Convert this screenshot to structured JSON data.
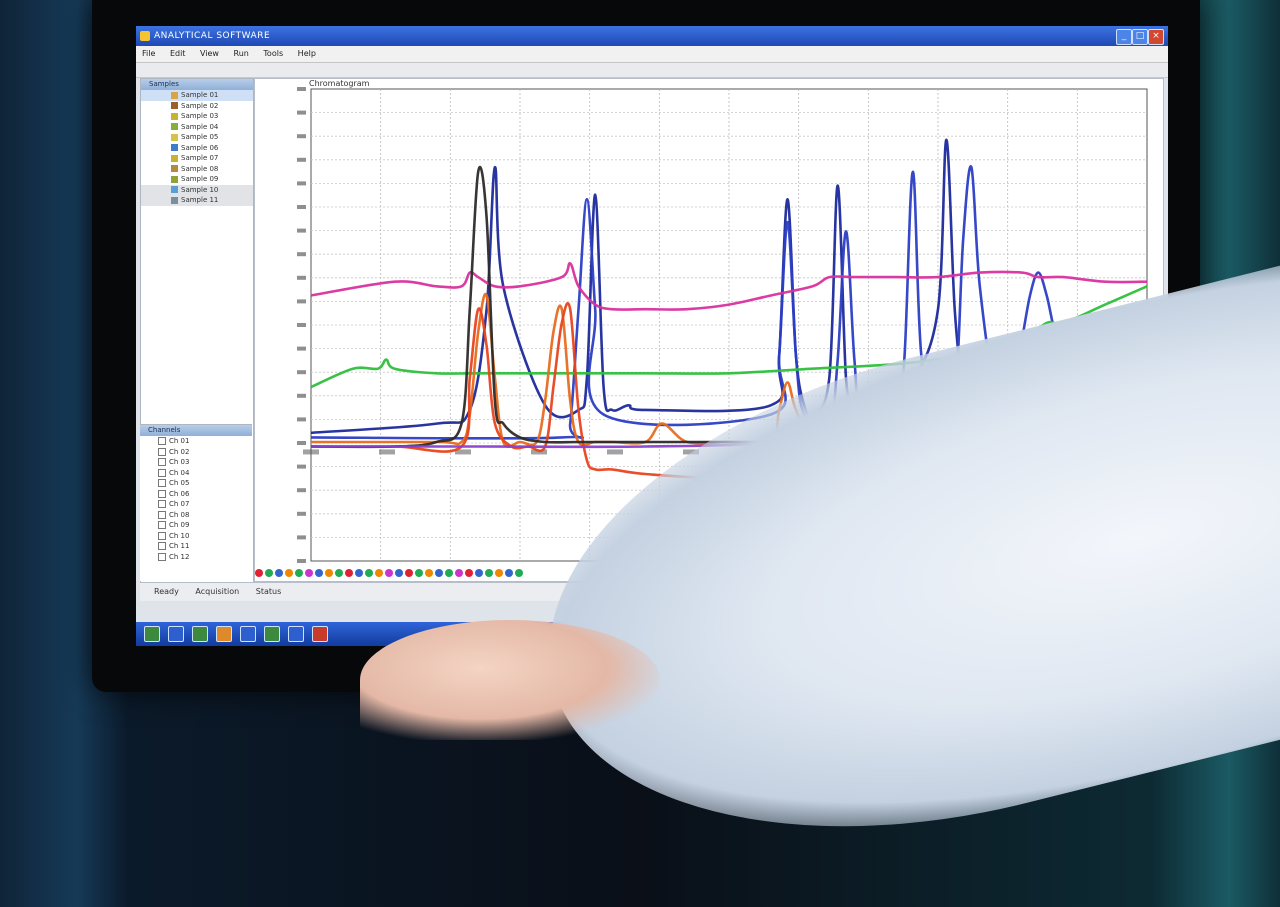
{
  "window": {
    "title": "ANALYTICAL SOFTWARE",
    "controls": [
      "_",
      "□",
      "×"
    ]
  },
  "menu": [
    "File",
    "Edit",
    "View",
    "Run",
    "Tools",
    "Help"
  ],
  "left_panel": {
    "header": "Samples",
    "rows": [
      {
        "label": "Sample 01",
        "color": "#d9a441"
      },
      {
        "label": "Sample 02",
        "color": "#9b5e2e"
      },
      {
        "label": "Sample 03",
        "color": "#c7b32f"
      },
      {
        "label": "Sample 04",
        "color": "#87ad3e"
      },
      {
        "label": "Sample 05",
        "color": "#d6c14a"
      },
      {
        "label": "Sample 06",
        "color": "#3e7cc9"
      },
      {
        "label": "Sample 07",
        "color": "#c7b32f"
      },
      {
        "label": "Sample 08",
        "color": "#b38a3e"
      },
      {
        "label": "Sample 09",
        "color": "#8fa33a"
      },
      {
        "label": "Sample 10",
        "color": "#5a9fd4"
      },
      {
        "label": "Sample 11",
        "color": "#7a8e9d"
      }
    ],
    "lower_header": "Channels",
    "lower_rows": [
      "Ch 01",
      "Ch 02",
      "Ch 03",
      "Ch 04",
      "Ch 05",
      "Ch 06",
      "Ch 07",
      "Ch 08",
      "Ch 09",
      "Ch 10",
      "Ch 11",
      "Ch 12"
    ]
  },
  "plot_header": "Chromatogram",
  "status": [
    "Ready",
    "Acquisition",
    "Status"
  ],
  "chart_data": {
    "type": "line",
    "ylim": [
      0,
      1
    ],
    "xlim": [
      0,
      100
    ],
    "grid": true,
    "x_tick_count": 11,
    "series": [
      {
        "color": "#1c2a9c",
        "x": [
          0,
          15,
          19,
          21,
          22,
          23,
          28,
          32,
          33,
          34,
          35,
          36,
          38,
          40,
          55,
          56,
          57,
          58,
          59,
          60,
          62,
          63,
          64,
          65,
          66,
          67,
          72,
          75,
          76,
          77,
          78,
          79,
          80,
          82,
          85,
          90,
          95,
          100
        ],
        "y": [
          0.28,
          0.3,
          0.33,
          0.55,
          0.86,
          0.6,
          0.34,
          0.33,
          0.4,
          0.8,
          0.38,
          0.33,
          0.34,
          0.33,
          0.34,
          0.45,
          0.79,
          0.45,
          0.34,
          0.32,
          0.4,
          0.82,
          0.4,
          0.34,
          0.34,
          0.35,
          0.4,
          0.55,
          0.92,
          0.55,
          0.38,
          0.36,
          0.4,
          0.38,
          0.36,
          0.35,
          0.34,
          0.33
        ]
      },
      {
        "color": "#2b3ec4",
        "x": [
          0,
          30,
          31,
          32,
          33,
          34,
          35,
          55,
          56,
          57,
          58,
          59,
          62,
          63,
          64,
          65,
          66,
          70,
          71,
          72,
          73,
          75,
          77,
          78,
          79,
          80,
          82,
          84,
          85,
          86,
          87,
          88,
          89,
          90,
          92,
          94,
          96,
          98,
          100
        ],
        "y": [
          0.27,
          0.27,
          0.3,
          0.55,
          0.79,
          0.55,
          0.32,
          0.32,
          0.45,
          0.74,
          0.45,
          0.32,
          0.3,
          0.44,
          0.72,
          0.44,
          0.3,
          0.3,
          0.45,
          0.85,
          0.45,
          0.3,
          0.35,
          0.7,
          0.86,
          0.6,
          0.36,
          0.4,
          0.48,
          0.58,
          0.63,
          0.58,
          0.5,
          0.48,
          0.49,
          0.48,
          0.53,
          0.47,
          0.45
        ]
      },
      {
        "color": "#d8329f",
        "x": [
          0,
          10,
          15,
          18,
          19,
          20,
          22,
          25,
          30,
          31,
          32,
          34,
          36,
          40,
          45,
          50,
          55,
          60,
          62,
          65,
          70,
          75,
          80,
          85,
          87,
          90,
          95,
          100
        ],
        "y": [
          0.58,
          0.61,
          0.6,
          0.6,
          0.63,
          0.62,
          0.6,
          0.6,
          0.62,
          0.65,
          0.6,
          0.56,
          0.55,
          0.55,
          0.55,
          0.56,
          0.58,
          0.6,
          0.62,
          0.62,
          0.62,
          0.62,
          0.63,
          0.63,
          0.62,
          0.62,
          0.61,
          0.61
        ]
      },
      {
        "color": "#2fbf3c",
        "x": [
          0,
          5,
          8,
          9,
          10,
          15,
          20,
          30,
          40,
          50,
          60,
          70,
          75,
          80,
          85,
          88,
          90,
          95,
          100
        ],
        "y": [
          0.38,
          0.42,
          0.42,
          0.44,
          0.42,
          0.41,
          0.41,
          0.41,
          0.41,
          0.41,
          0.42,
          0.43,
          0.44,
          0.45,
          0.48,
          0.52,
          0.52,
          0.56,
          0.6
        ]
      },
      {
        "color": "#e86b1c",
        "x": [
          0,
          15,
          18,
          19,
          20,
          21,
          22,
          23,
          25,
          27,
          28,
          29,
          30,
          31,
          32,
          34,
          36,
          40,
          42,
          45,
          50,
          55,
          56,
          57,
          58,
          60,
          65,
          68,
          70,
          72,
          75,
          80,
          85,
          90,
          95,
          100
        ],
        "y": [
          0.26,
          0.26,
          0.26,
          0.32,
          0.5,
          0.58,
          0.4,
          0.26,
          0.26,
          0.26,
          0.35,
          0.5,
          0.55,
          0.35,
          0.26,
          0.26,
          0.26,
          0.26,
          0.3,
          0.26,
          0.26,
          0.26,
          0.33,
          0.39,
          0.33,
          0.26,
          0.27,
          0.3,
          0.33,
          0.34,
          0.33,
          0.33,
          0.33,
          0.32,
          0.32,
          0.31
        ]
      },
      {
        "color": "#e8451f",
        "x": [
          0,
          10,
          18,
          19,
          20,
          21,
          22,
          24,
          26,
          28,
          29,
          30,
          31,
          32,
          33,
          34,
          36,
          40,
          50,
          60,
          65,
          70,
          72,
          73,
          75,
          80,
          85,
          90,
          95,
          100
        ],
        "y": [
          0.25,
          0.25,
          0.25,
          0.4,
          0.55,
          0.47,
          0.3,
          0.25,
          0.25,
          0.25,
          0.38,
          0.52,
          0.55,
          0.33,
          0.22,
          0.2,
          0.2,
          0.19,
          0.18,
          0.19,
          0.21,
          0.2,
          0.22,
          0.23,
          0.21,
          0.2,
          0.21,
          0.21,
          0.2,
          0.19
        ]
      },
      {
        "color": "#2d2a2a",
        "x": [
          0,
          10,
          15,
          18,
          19,
          20,
          21,
          22,
          23,
          25,
          28,
          32,
          36,
          40,
          45,
          50,
          55,
          60,
          65,
          70,
          75,
          80,
          85,
          90,
          95,
          100
        ],
        "y": [
          0.25,
          0.25,
          0.26,
          0.3,
          0.55,
          0.85,
          0.75,
          0.35,
          0.3,
          0.27,
          0.26,
          0.26,
          0.26,
          0.26,
          0.26,
          0.26,
          0.26,
          0.26,
          0.27,
          0.27,
          0.27,
          0.27,
          0.27,
          0.27,
          0.27,
          0.27
        ]
      },
      {
        "color": "#8a3fcf",
        "x": [
          0,
          20,
          40,
          55,
          58,
          60,
          62,
          65,
          68,
          70,
          72,
          75,
          78,
          80,
          82,
          84,
          86,
          88,
          90,
          95,
          100
        ],
        "y": [
          0.25,
          0.25,
          0.25,
          0.26,
          0.3,
          0.27,
          0.3,
          0.33,
          0.3,
          0.27,
          0.33,
          0.36,
          0.3,
          0.28,
          0.32,
          0.3,
          0.28,
          0.3,
          0.3,
          0.28,
          0.27
        ]
      }
    ]
  },
  "taskbar_icons": [
    "app-1",
    "app-2",
    "app-3",
    "app-4",
    "app-5",
    "app-6",
    "app-7",
    "app-8"
  ]
}
